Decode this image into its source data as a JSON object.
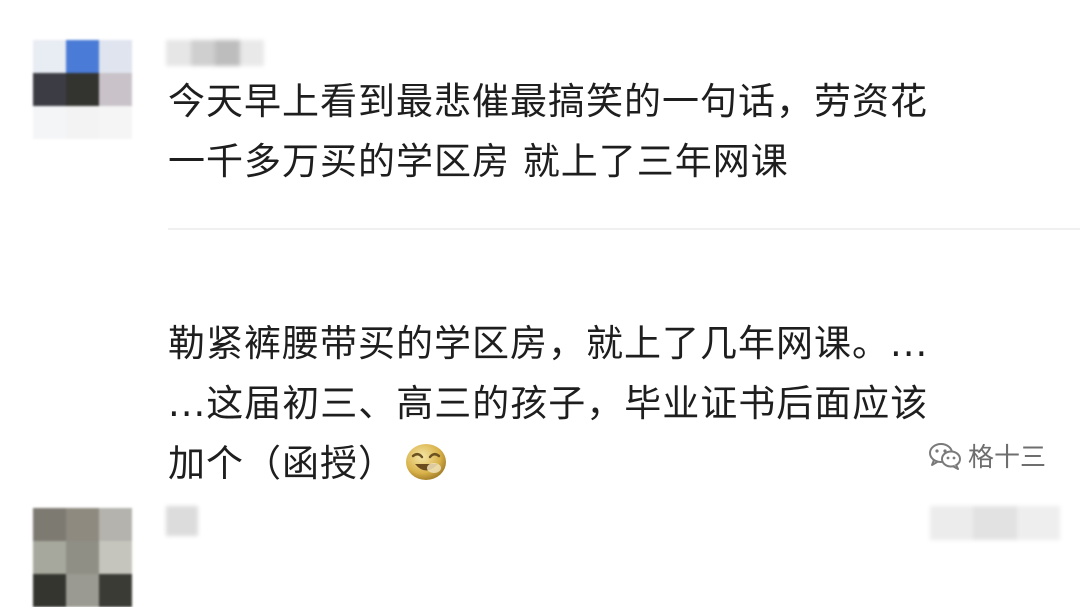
{
  "comments": [
    {
      "avatar_colors": [
        "#e8ecf3",
        "#4a7bd6",
        "#dfe4ee",
        "#3c3c44",
        "#333330",
        "#c9c3c9",
        "#f4f5f7",
        "#f3f3f3",
        "#f5f5f5"
      ],
      "name_blur_colors": [
        "#e6e6e6",
        "#cfcfcf",
        "#bdbdbd",
        "#e9e9e9"
      ],
      "text_lines": [
        "今天早上看到最悲催最搞笑的一句话，劳资花",
        "一千多万买的学区房 就上了三年网课"
      ]
    },
    {
      "avatar_colors": [
        "#7d7a72",
        "#8e8a80",
        "#b4b3ad",
        "#a6a89d",
        "#8f8f86",
        "#c5c5bd",
        "#34352f",
        "#9b9a92",
        "#3b3b36"
      ],
      "name_blur_colors": [
        "#dcdcdc"
      ],
      "time_blur_colors": [
        "#ececec",
        "#e2e2e2",
        "#eeeeee"
      ],
      "text_lines": [
        "勒紧裤腰带买的学区房，就上了几年网课。...",
        "...这届初三、高三的孩子，毕业证书后面应该",
        "加个（函授）"
      ],
      "emoji_icon": "laughing-face-emoji-icon"
    }
  ],
  "watermark": {
    "icon": "wechat-icon",
    "text": "格十三"
  }
}
